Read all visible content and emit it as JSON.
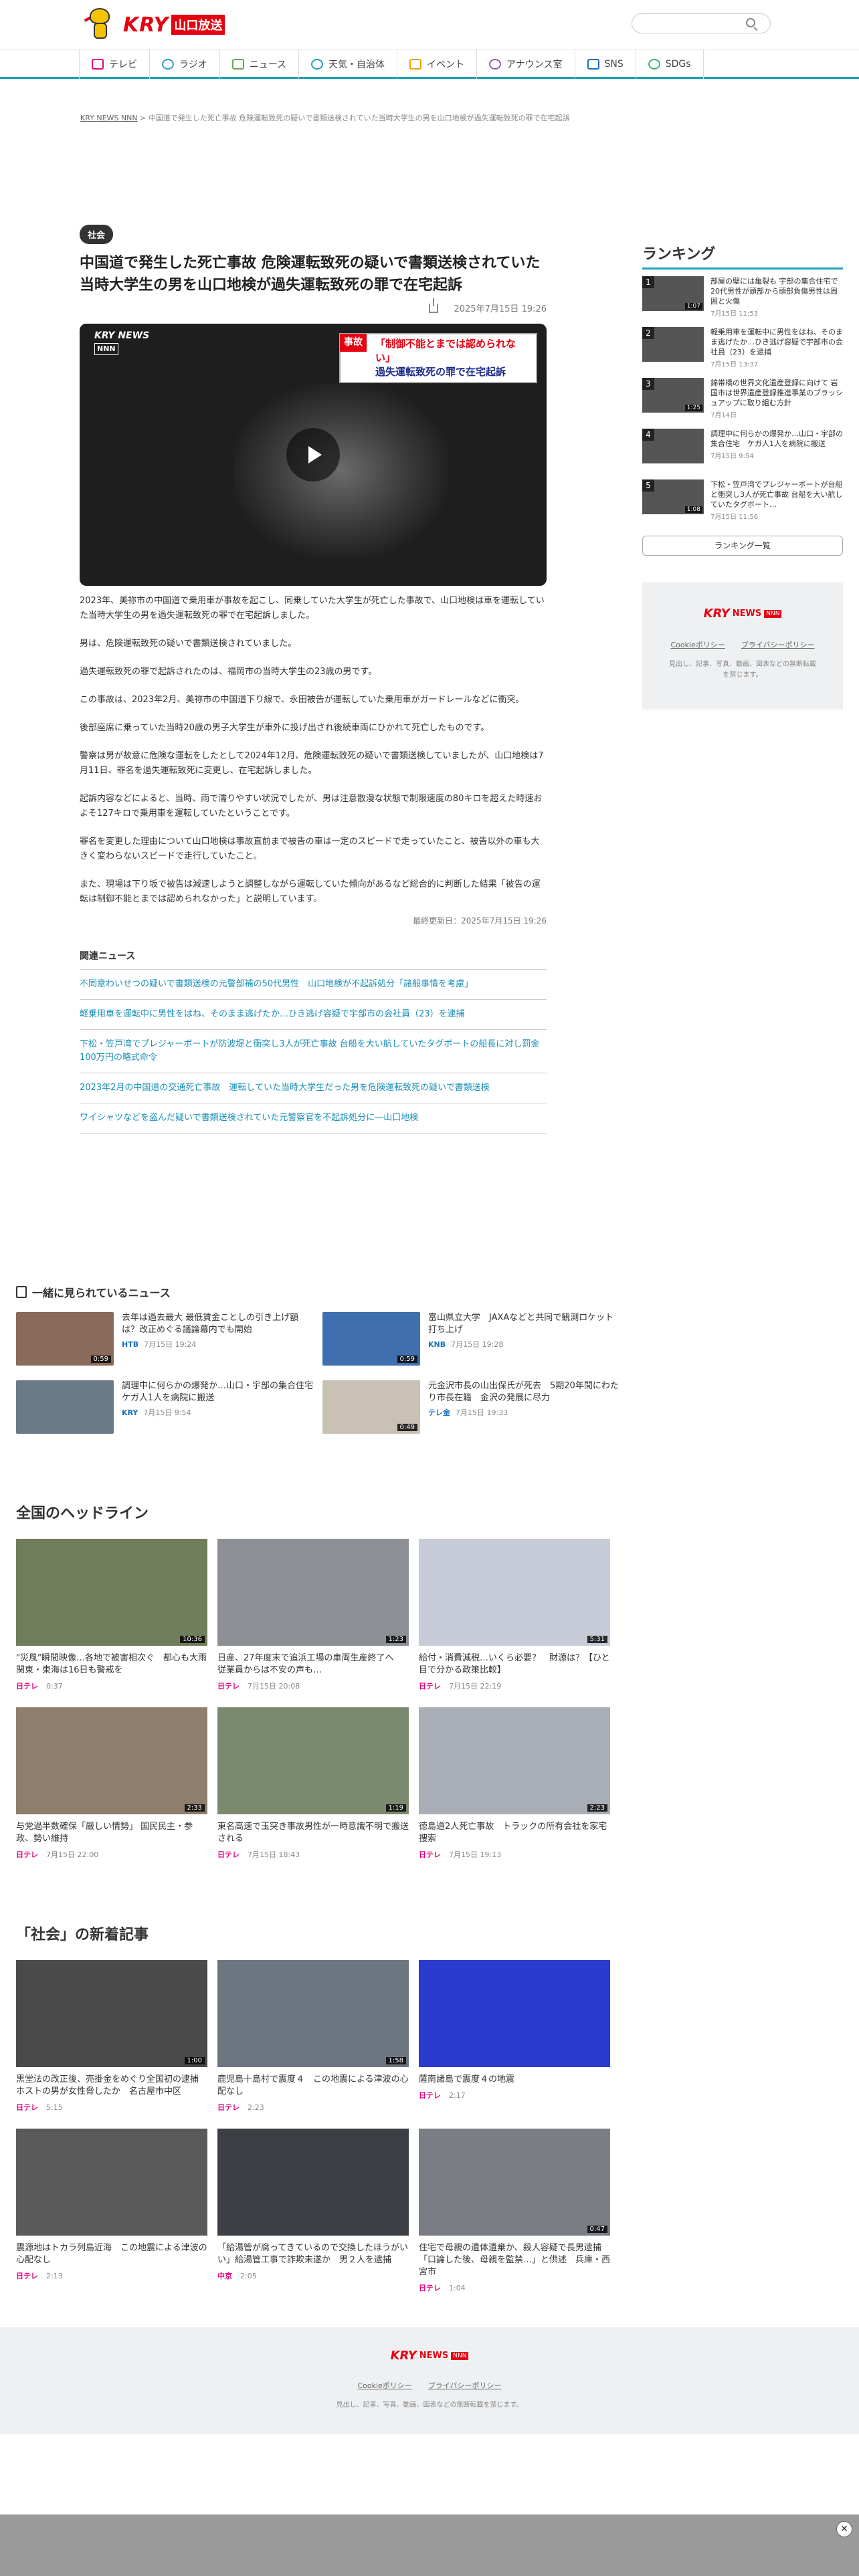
{
  "site": {
    "brand": "KRY",
    "brand_sub": "山口放送"
  },
  "search": {
    "placeholder": ""
  },
  "nav": [
    {
      "label": "テレビ",
      "color": "#e6007e"
    },
    {
      "label": "ラジオ",
      "color": "#2e9bd6"
    },
    {
      "label": "ニュース",
      "color": "#6aa84f"
    },
    {
      "label": "天気・自治体",
      "color": "#1aa0b8"
    },
    {
      "label": "イベント",
      "color": "#f0a000"
    },
    {
      "label": "アナウンス室",
      "color": "#9b59b6"
    },
    {
      "label": "SNS",
      "color": "#1a6fc0"
    },
    {
      "label": "SDGs",
      "color": "#3cb371"
    }
  ],
  "breadcrumb": {
    "home": "KRY NEWS NNN",
    "sep": ">",
    "current": "中国道で発生した死亡事故 危険運転致死の疑いで書類送検されていた当時大学生の男を山口地検が過失運転致死の罪で在宅起訴"
  },
  "article": {
    "tag": "社会",
    "title": "中国道で発生した死亡事故 危険運転致死の疑いで書類送検されていた当時大学生の男を山口地検が過失運転致死の罪で在宅起訴",
    "date": "2025年7月15日 19:26",
    "video": {
      "logo": "KRY NEWS",
      "logo_nnn": "NNN",
      "telop_tag": "事故",
      "telop_line1": "「制御不能とまでは認められない」",
      "telop_line2": "過失運転致死の罪で在宅起訴"
    },
    "paragraphs": [
      "2023年、美祢市の中国道で乗用車が事故を起こし、同乗していた大学生が死亡した事故で、山口地検は車を運転していた当時大学生の男を過失運転致死の罪で在宅起訴しました。",
      "男は、危険運転致死の疑いで書類送検されていました。",
      "過失運転致死の罪で起訴されたのは、福岡市の当時大学生の23歳の男です。",
      "この事故は、2023年2月、美祢市の中国道下り線で、永田被告が運転していた乗用車がガードレールなどに衝突。",
      "後部座席に乗っていた当時20歳の男子大学生が車外に投げ出され後続車両にひかれて死亡したものです。",
      "警察は男が故意に危険な運転をしたとして2024年12月、危険運転致死の疑いで書類送検していましたが、山口地検は7月11日、罪名を過失運転致死に変更し、在宅起訴しました。",
      "起訴内容などによると、当時、雨で濡りやすい状況でしたが、男は注意散漫な状態で制限速度の80キロを超えた時速およそ127キロで乗用車を運転していたということです。",
      "罪名を変更した理由について山口地検は事故直前まで被告の車は一定のスピードで走っていたこと、被告以外の車も大きく変わらないスピードで走行していたこと。",
      "また、現場は下り坂で被告は減速しようと調整しながら運転していた傾向があるなど総合的に判断した結果「被告の運転は制御不能とまでは認められなかった」と説明しています。"
    ],
    "updated": "最終更新日：2025年7月15日 19:26"
  },
  "related": {
    "heading": "関連ニュース",
    "items": [
      "不同意わいせつの疑いで書類送検の元警部補の50代男性　山口地検が不起訴処分「諸般事情を考慮」",
      "軽乗用車を運転中に男性をはね、そのまま逃げたか…ひき逃げ容疑で宇部市の会社員（23）を逮捕",
      "下松・笠戸湾でプレジャーボートが防波堤と衝突し3人が死亡事故 台船を大い航していたタグボートの船長に対し罰金100万円の略式命令",
      "2023年2月の中国道の交通死亡事故　運転していた当時大学生だった男を危険運転致死の疑いで書類送検",
      "ワイシャツなどを盗んだ疑いで書類送検されていた元警察官を不起訴処分に―山口地検"
    ]
  },
  "ranking": {
    "heading": "ランキング",
    "items": [
      {
        "num": "1",
        "title": "部屋の壁には亀裂も 宇部の集合住宅で20代男性が頭部から頭部負傷男性は周囲と火傷",
        "date": "7月15日 11:53",
        "dur": "1:07"
      },
      {
        "num": "2",
        "title": "軽乗用車を運転中に男性をはね、そのまま逃げたか…ひき逃げ容疑で宇部市の会社員（23）を逮捕",
        "date": "7月15日 13:37",
        "dur": ""
      },
      {
        "num": "3",
        "title": "錦帯橋の世界文化遺産登録に向けて 岩国市は世界遺産登録推進事業のブラッシュアップに取り組む方針",
        "date": "7月14日",
        "dur": "1:25"
      },
      {
        "num": "4",
        "title": "調理中に何らかの爆発か…山口・宇部の集合住宅　ケガ人1人を病院に搬送",
        "date": "7月15日 9:54",
        "dur": ""
      },
      {
        "num": "5",
        "title": "下松・笠戸湾でプレジャーボートが台船と衝突し3人が死亡事故 台船を大い航していたタグボート…",
        "date": "7月15日 11:56",
        "dur": "1:08"
      }
    ],
    "more": "ランキング一覧"
  },
  "side_footer": {
    "logo_kry": "KRY",
    "logo_news": "NEWS",
    "logo_nnn": "NNN",
    "cookie": "Cookieポリシー",
    "privacy": "プライバシーポリシー",
    "copy": "見出し、記事、写真、動画、図表などの無断転載を禁じます。"
  },
  "seen": {
    "heading": "一緒に見られているニュース",
    "items": [
      {
        "title": "去年は過去最大 最低賃金ことしの引き上げ額は？改正めぐる議論幕内でも開始",
        "source": "HTB",
        "date": "7月15日 19:24",
        "dur": "0:59"
      },
      {
        "title": "富山県立大学　JAXAなどと共同で観測ロケット打ち上げ",
        "source": "KNB",
        "date": "7月15日 19:28",
        "dur": "0:59"
      },
      {
        "title": "調理中に何らかの爆発か…山口・宇部の集合住宅　ケガ人1人を病院に搬送",
        "source": "KRY",
        "date": "7月15日 9:54",
        "dur": ""
      },
      {
        "title": "元金沢市長の山出保氏が死去　5期20年間にわたり市長在籍　金沢の発展に尽力",
        "source": "テレ金",
        "date": "7月15日 19:33",
        "dur": "0:49"
      }
    ]
  },
  "headlines": {
    "heading": "全国のヘッドライン",
    "items": [
      {
        "title": "\"災風\"瞬間映像…各地で被害相次ぐ　都心も大雨　関東・東海は16日も警戒を",
        "source": "日テレ",
        "date": "0:37",
        "dur": "10:36"
      },
      {
        "title": "日産、27年度末で追浜工場の車両生産終了へ　従業員からは不安の声も…",
        "source": "日テレ",
        "date": "7月15日 20:08",
        "dur": "1:23"
      },
      {
        "title": "給付・消費減税…いくら必要？　財源は？【ひと目で分かる政策比較】",
        "source": "日テレ",
        "date": "7月15日 22:19",
        "dur": "5:31"
      },
      {
        "title": "与党過半数確保「厳しい情勢」 国民民主・参政、勢い維持",
        "source": "日テレ",
        "date": "7月15日 22:00",
        "dur": "2:33"
      },
      {
        "title": "東名高速で玉突き事故男性が一時意識不明で搬送される",
        "source": "日テレ",
        "date": "7月15日 18:43",
        "dur": "1:19"
      },
      {
        "title": "徳島道2人死亡事故　トラックの所有会社を家宅捜索",
        "source": "日テレ",
        "date": "7月15日 19:13",
        "dur": "2:23"
      }
    ]
  },
  "shakai": {
    "heading": "「社会」の新着記事",
    "items": [
      {
        "title": "黒堂法の改正後、売掛金をめぐり全国初の逮捕　ホストの男が女性脅したか　名古屋市中区",
        "source": "日テレ",
        "date": "5:15",
        "dur": "1:00"
      },
      {
        "title": "鹿児島十島村で震度４　この地震による津波の心配なし",
        "source": "日テレ",
        "date": "2:23",
        "dur": "1:58"
      },
      {
        "title": "薩南諸島で震度４の地震",
        "source": "日テレ",
        "date": "2:17",
        "dur": ""
      },
      {
        "title": "震源地はトカラ列島近海　この地震による津波の心配なし",
        "source": "日テレ",
        "date": "2:13",
        "dur": ""
      },
      {
        "title": "「給湯管が腐ってきているので交換したほうがいい」給湯管工事で詐欺未遂か　男２人を逮捕",
        "source": "中京",
        "date": "2:05",
        "dur": ""
      },
      {
        "title": "住宅で母親の遺体遺棄か、殺人容疑で長男逮捕「口論した後、母親を監禁…」と供述　兵庫・西宮市",
        "source": "日テレ",
        "date": "1:04",
        "dur": "0:47"
      }
    ]
  },
  "footer": {
    "logo_kry": "KRY",
    "logo_news": "NEWS",
    "logo_nnn": "NNN",
    "cookie": "Cookieポリシー",
    "privacy": "プライバシーポリシー",
    "copy": "見出し、記事、写真、動画、図表などの無断転載を禁じます。"
  },
  "ad": {
    "close": "✕"
  },
  "colors": {
    "accent": "#1aa0b8",
    "brand_red": "#e60012",
    "link": "#1a8fb8"
  }
}
